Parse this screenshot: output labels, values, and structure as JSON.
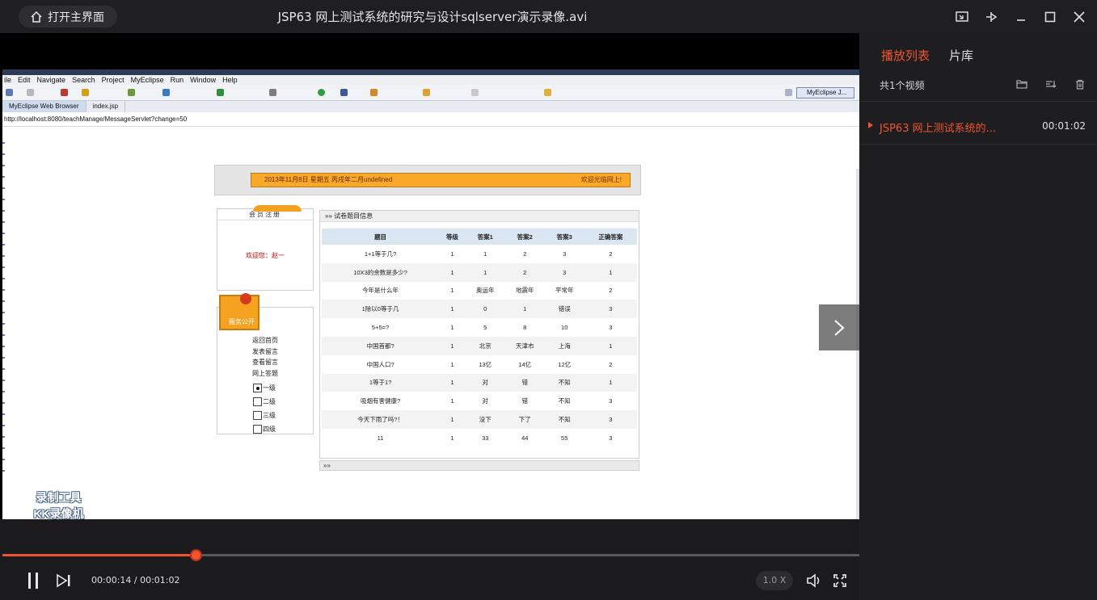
{
  "titlebar": {
    "home_label": "打开主界面",
    "title": "JSP63 网上测试系统的研究与设计sqlserver演示录像.avi"
  },
  "eclipse": {
    "menu": [
      "ile",
      "Edit",
      "Navigate",
      "Search",
      "Project",
      "MyEclipse",
      "Run",
      "Window",
      "Help"
    ],
    "perspective": "MyEclipse J...",
    "tabs": [
      "MyEclipse Web Browser",
      "index.jsp"
    ],
    "url": "http://localhost:8080/teachManage/MessageServlet?change=50"
  },
  "site": {
    "banner_date": "2013年11月8日 星期五 丙戌年二月undefined",
    "banner_welcome": "欢迎光临网上!",
    "login_title": "会员注册",
    "login_msg": "欢迎您：赵一",
    "nav_badge": "服务公开",
    "nav_links": [
      "返回首页",
      "发表留言",
      "查看留言",
      "网上答题"
    ],
    "levels": [
      "一级",
      "二级",
      "三级",
      "四级"
    ],
    "panel_title": "试卷题目信息",
    "columns": [
      "题目",
      "等级",
      "答案1",
      "答案2",
      "答案3",
      "正确答案"
    ],
    "rows": [
      [
        "1+1等于几?",
        "1",
        "1",
        "2",
        "3",
        "2"
      ],
      [
        "10X3的余数是多少?",
        "1",
        "1",
        "2",
        "3",
        "1"
      ],
      [
        "今年是什么年",
        "1",
        "奥运年",
        "地震年",
        "平常年",
        "2"
      ],
      [
        "1除以0等于几",
        "1",
        "0",
        "1",
        "错误",
        "3"
      ],
      [
        "5+5=?",
        "1",
        "5",
        "8",
        "10",
        "3"
      ],
      [
        "中国首都?",
        "1",
        "北京",
        "天津市",
        "上海",
        "1"
      ],
      [
        "中国人口?",
        "1",
        "13亿",
        "14亿",
        "12亿",
        "2"
      ],
      [
        "1等于1?",
        "1",
        "对",
        "错",
        "不知",
        "1"
      ],
      [
        "吸烟有害健康?",
        "1",
        "对",
        "错",
        "不知",
        "3"
      ],
      [
        "今天下雨了吗?！",
        "1",
        "没下",
        "下了",
        "不知",
        "3"
      ],
      [
        "11",
        "1",
        "33",
        "44",
        "55",
        "3"
      ]
    ]
  },
  "watermark": {
    "line1": "录制工具",
    "line2": "KK录像机"
  },
  "player": {
    "time": "00:00:14 / 00:01:02",
    "progress": 0.226,
    "speed": "1.0 X"
  },
  "playlist": {
    "tabs": [
      "播放列表",
      "片库"
    ],
    "count": "共1个视频",
    "items": [
      {
        "name": "JSP63 网上测试系统的...",
        "duration": "00:01:02"
      }
    ]
  },
  "colors": {
    "accent": "#f0532d",
    "banner": "#f9a82a"
  }
}
